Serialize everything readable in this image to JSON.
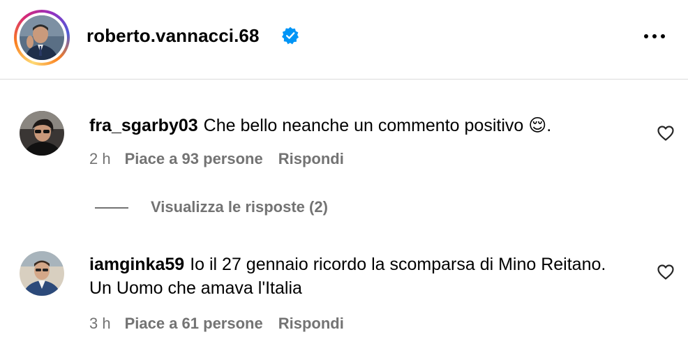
{
  "header": {
    "username": "roberto.vannacci.68",
    "verified_icon": "verified-badge-icon",
    "more_icon": "more-options-icon"
  },
  "colors": {
    "accent": "#0095f6",
    "muted": "#737373",
    "divider": "#dbdbdb"
  },
  "comments": [
    {
      "author": "fra_sgarby03",
      "text": "Che bello neanche un commento positivo 😌.",
      "time": "2 h",
      "likes": "Piace a 93 persone",
      "reply": "Rispondi",
      "view_replies": "Visualizza le risposte (2)"
    },
    {
      "author": "iamginka59",
      "text": "Io il 27 gennaio ricordo la scomparsa di Mino Reitano. Un Uomo che amava l'Italia",
      "time": "3 h",
      "likes": "Piace a 61 persone",
      "reply": "Rispondi"
    }
  ]
}
